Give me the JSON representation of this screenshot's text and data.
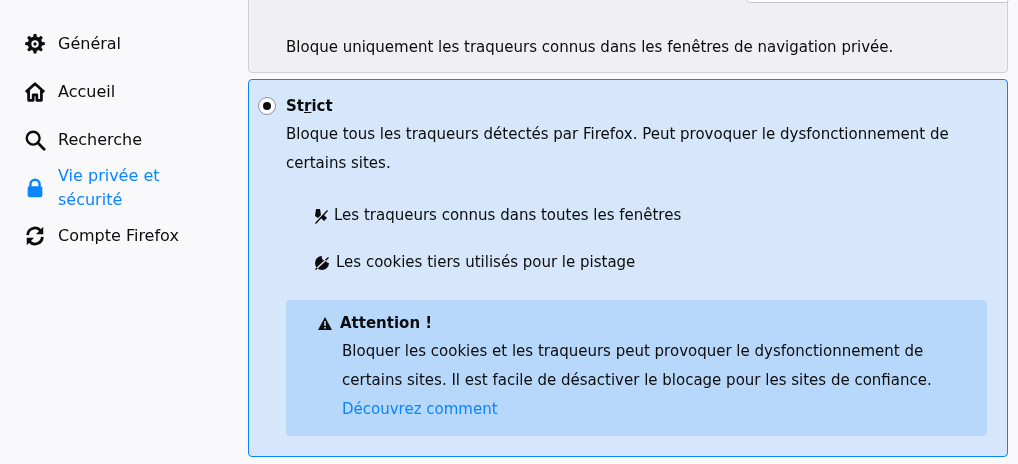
{
  "sidebar": {
    "items": [
      {
        "label": "Général",
        "kind": "gear",
        "selected": false
      },
      {
        "label": "Accueil",
        "kind": "home",
        "selected": false
      },
      {
        "label": "Recherche",
        "kind": "search",
        "selected": false
      },
      {
        "label": "Vie privée et sécurité",
        "kind": "lock",
        "selected": true
      },
      {
        "label": "Compte Firefox",
        "kind": "sync",
        "selected": false
      }
    ]
  },
  "options": [
    {
      "description": "Bloque uniquement les traqueurs connus dans les fenêtres de navigation privée.",
      "selected": false
    },
    {
      "title_start": "St",
      "accesskey": "r",
      "title_end": "ict",
      "description": "Bloque tous les traqueurs détectés par Firefox. Peut provoquer le dysfonctionnement de certains sites.",
      "selected": true,
      "features": [
        {
          "kind": "tracker",
          "label": "Les traqueurs connus dans toutes les fenêtres"
        },
        {
          "kind": "cookie",
          "label": "Les cookies tiers utilisés pour le pistage"
        }
      ],
      "warning": {
        "title": "Attention !",
        "text": "Bloquer les cookies et les traqueurs peut provoquer le dysfonctionnement de certains sites. Il est facile de désactiver le blocage pour les sites de confiance.",
        "link": "Découvrez comment"
      }
    }
  ]
}
